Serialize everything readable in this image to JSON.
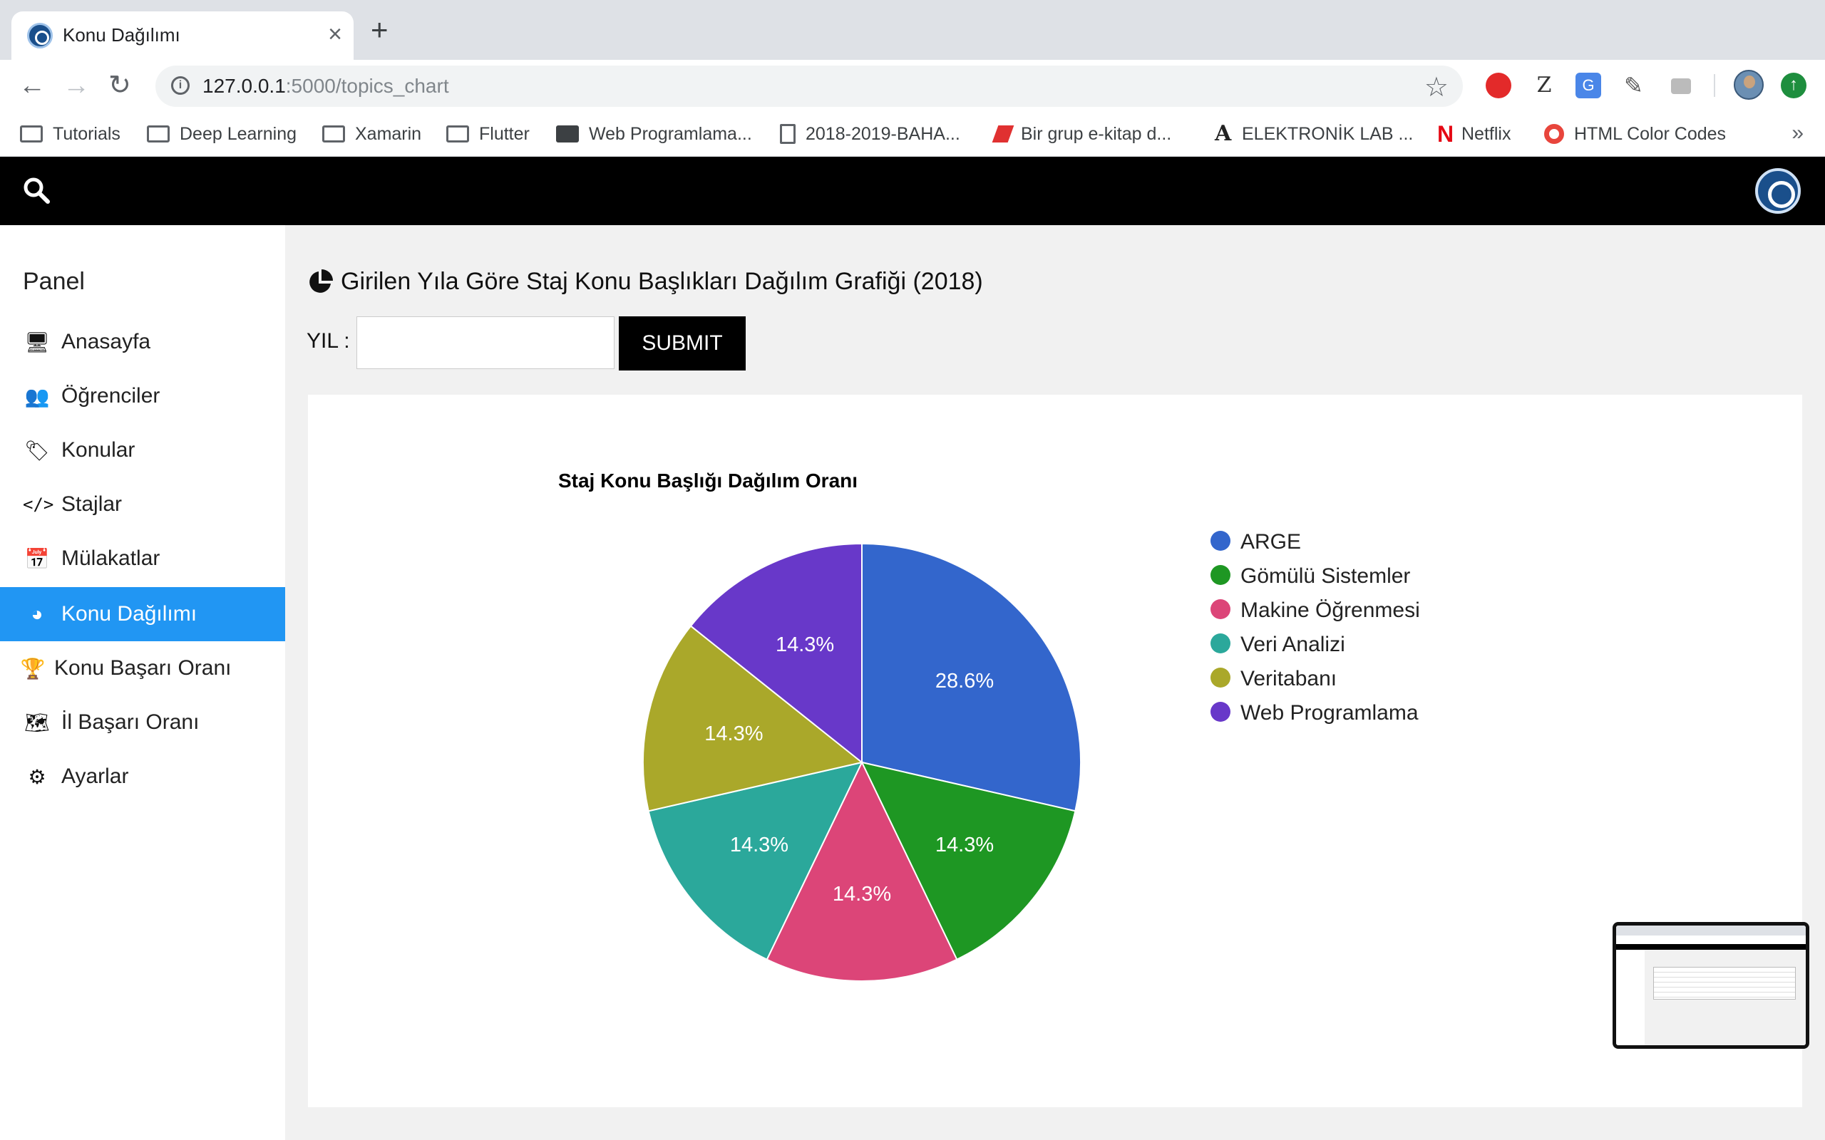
{
  "browser": {
    "tab_title": "Konu Dağılımı",
    "url_host": "127.0.0.1",
    "url_rest": ":5000/topics_chart",
    "bookmarks": [
      {
        "label": "Tutorials",
        "icon": "folder-icon"
      },
      {
        "label": "Deep Learning",
        "icon": "folder-icon"
      },
      {
        "label": "Xamarin",
        "icon": "folder-icon"
      },
      {
        "label": "Flutter",
        "icon": "folder-icon"
      },
      {
        "label": "Web Programlama...",
        "icon": "classroom-icon"
      },
      {
        "label": "2018-2019-BAHA...",
        "icon": "document-icon"
      },
      {
        "label": "Bir grup e-kitap d...",
        "icon": "book-icon"
      },
      {
        "label": "ELEKTRONİK LAB ...",
        "icon": "letter-a-icon"
      },
      {
        "label": "Netflix",
        "icon": "netflix-icon"
      },
      {
        "label": "HTML Color Codes",
        "icon": "color-wheel-icon"
      }
    ],
    "ext_z": "Z",
    "ext_translate": "G",
    "update": "↑"
  },
  "sidebar": {
    "title": "Panel",
    "items": [
      {
        "label": "Anasayfa",
        "icon": "monitor-icon",
        "glyph": "🖥"
      },
      {
        "label": "Öğrenciler",
        "icon": "users-icon",
        "glyph": "👥"
      },
      {
        "label": "Konular",
        "icon": "tags-icon",
        "glyph": "🏷"
      },
      {
        "label": "Stajlar",
        "icon": "code-icon",
        "glyph": "</>"
      },
      {
        "label": "Mülakatlar",
        "icon": "calendar-icon",
        "glyph": "📅"
      },
      {
        "label": "Konu Dağılımı",
        "icon": "pie-chart-icon",
        "glyph": "◕",
        "active": true
      },
      {
        "label": "Konu Başarı Oranı",
        "icon": "trophy-icon",
        "glyph": "🏆"
      },
      {
        "label": "İl Başarı Oranı",
        "icon": "map-icon",
        "glyph": "🗺"
      },
      {
        "label": "Ayarlar",
        "icon": "gear-icon",
        "glyph": "⚙"
      }
    ]
  },
  "main": {
    "title": "Girilen Yıla Göre Staj Konu Başlıkları Dağılım Grafiği (2018)",
    "year_label": "YIL :",
    "year_value": "",
    "submit_label": "SUBMIT"
  },
  "chart_data": {
    "type": "pie",
    "title": "Staj Konu Başlığı Dağılım Oranı",
    "categories": [
      "ARGE",
      "Gömülü Sistemler",
      "Makine Öğrenmesi",
      "Veri Analizi",
      "Veritabanı",
      "Web Programlama"
    ],
    "values": [
      28.6,
      14.3,
      14.3,
      14.3,
      14.3,
      14.3
    ],
    "labels": [
      "28.6%",
      "14.3%",
      "14.3%",
      "14.3%",
      "14.3%",
      "14.3%"
    ],
    "colors": [
      "#3366cc",
      "#1e9723",
      "#dc4578",
      "#2ba89b",
      "#aaa82a",
      "#6838c9"
    ],
    "legend_position": "right"
  }
}
